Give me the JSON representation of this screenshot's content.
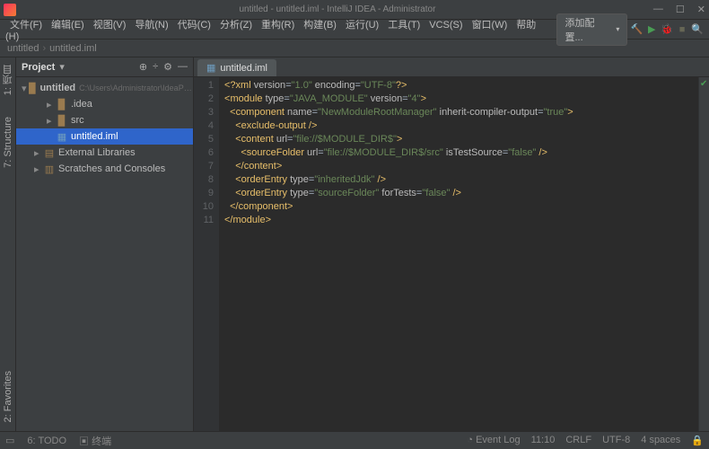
{
  "window": {
    "title": "untitled - untitled.iml - IntelliJ IDEA - Administrator"
  },
  "menu": {
    "items": [
      "文件(F)",
      "编辑(E)",
      "视图(V)",
      "导航(N)",
      "代码(C)",
      "分析(Z)",
      "重构(R)",
      "构建(B)",
      "运行(U)",
      "工具(T)",
      "VCS(S)",
      "窗口(W)",
      "帮助(H)"
    ],
    "run_config": "添加配置..."
  },
  "breadcrumb": {
    "project": "untitled",
    "file": "untitled.iml"
  },
  "left_tabs": {
    "project": "1: 项目",
    "structure": "7: Structure",
    "favorites": "2: Favorites"
  },
  "project": {
    "title": "Project",
    "root_name": "untitled",
    "root_path": "C:\\Users\\Administrator\\IdeaProjects\\untitled",
    "items": [
      {
        "name": ".idea",
        "depth": 1,
        "kind": "folder",
        "expanded": false
      },
      {
        "name": "src",
        "depth": 1,
        "kind": "src",
        "expanded": false
      },
      {
        "name": "untitled.iml",
        "depth": 1,
        "kind": "file",
        "selected": true
      },
      {
        "name": "External Libraries",
        "depth": 0,
        "kind": "lib",
        "expanded": false
      },
      {
        "name": "Scratches and Consoles",
        "depth": 0,
        "kind": "scratch",
        "expanded": false
      }
    ]
  },
  "editor": {
    "tab": "untitled.iml",
    "lines": [
      [
        [
          "brkt",
          "<?"
        ],
        [
          "tag",
          "xml"
        ],
        [
          "",
          ""
        ],
        [
          "attr",
          " version"
        ],
        [
          "",
          "="
        ],
        [
          "str",
          "\"1.0\""
        ],
        [
          "attr",
          " encoding"
        ],
        [
          "",
          "="
        ],
        [
          "str",
          "\"UTF-8\""
        ],
        [
          "brkt",
          "?>"
        ]
      ],
      [
        [
          "brkt",
          "<"
        ],
        [
          "tag",
          "module"
        ],
        [
          "attr",
          " type"
        ],
        [
          "",
          "="
        ],
        [
          "str",
          "\"JAVA_MODULE\""
        ],
        [
          "attr",
          " version"
        ],
        [
          "",
          "="
        ],
        [
          "str",
          "\"4\""
        ],
        [
          "brkt",
          ">"
        ]
      ],
      [
        [
          "",
          "  "
        ],
        [
          "brkt",
          "<"
        ],
        [
          "tag",
          "component"
        ],
        [
          "attr",
          " name"
        ],
        [
          "",
          "="
        ],
        [
          "str",
          "\"NewModuleRootManager\""
        ],
        [
          "attr",
          " inherit-compiler-output"
        ],
        [
          "",
          "="
        ],
        [
          "str",
          "\"true\""
        ],
        [
          "brkt",
          ">"
        ]
      ],
      [
        [
          "",
          "    "
        ],
        [
          "brkt",
          "<"
        ],
        [
          "tag",
          "exclude-output"
        ],
        [
          "brkt",
          " />"
        ]
      ],
      [
        [
          "",
          "    "
        ],
        [
          "brkt",
          "<"
        ],
        [
          "tag",
          "content"
        ],
        [
          "attr",
          " url"
        ],
        [
          "",
          "="
        ],
        [
          "str",
          "\"file://$MODULE_DIR$\""
        ],
        [
          "brkt",
          ">"
        ]
      ],
      [
        [
          "",
          "      "
        ],
        [
          "brkt",
          "<"
        ],
        [
          "tag",
          "sourceFolder"
        ],
        [
          "attr",
          " url"
        ],
        [
          "",
          "="
        ],
        [
          "str",
          "\"file://$MODULE_DIR$/src\""
        ],
        [
          "attr",
          " isTestSource"
        ],
        [
          "",
          "="
        ],
        [
          "str",
          "\"false\""
        ],
        [
          "brkt",
          " />"
        ]
      ],
      [
        [
          "",
          "    "
        ],
        [
          "brkt",
          "</"
        ],
        [
          "tag",
          "content"
        ],
        [
          "brkt",
          ">"
        ]
      ],
      [
        [
          "",
          "    "
        ],
        [
          "brkt",
          "<"
        ],
        [
          "tag",
          "orderEntry"
        ],
        [
          "attr",
          " type"
        ],
        [
          "",
          "="
        ],
        [
          "str",
          "\"inheritedJdk\""
        ],
        [
          "brkt",
          " />"
        ]
      ],
      [
        [
          "",
          "    "
        ],
        [
          "brkt",
          "<"
        ],
        [
          "tag",
          "orderEntry"
        ],
        [
          "attr",
          " type"
        ],
        [
          "",
          "="
        ],
        [
          "str",
          "\"sourceFolder\""
        ],
        [
          "attr",
          " forTests"
        ],
        [
          "",
          "="
        ],
        [
          "str",
          "\"false\""
        ],
        [
          "brkt",
          " />"
        ]
      ],
      [
        [
          "",
          "  "
        ],
        [
          "brkt",
          "</"
        ],
        [
          "tag",
          "component"
        ],
        [
          "brkt",
          ">"
        ]
      ],
      [
        [
          "brkt",
          "</"
        ],
        [
          "tag",
          "module"
        ],
        [
          "brkt",
          ">"
        ]
      ]
    ]
  },
  "status": {
    "todo": "6: TODO",
    "terminal": "终端",
    "event_log": "Event Log",
    "pos": "11:10",
    "eol": "CRLF",
    "enc": "UTF-8",
    "indent": "4 spaces"
  }
}
